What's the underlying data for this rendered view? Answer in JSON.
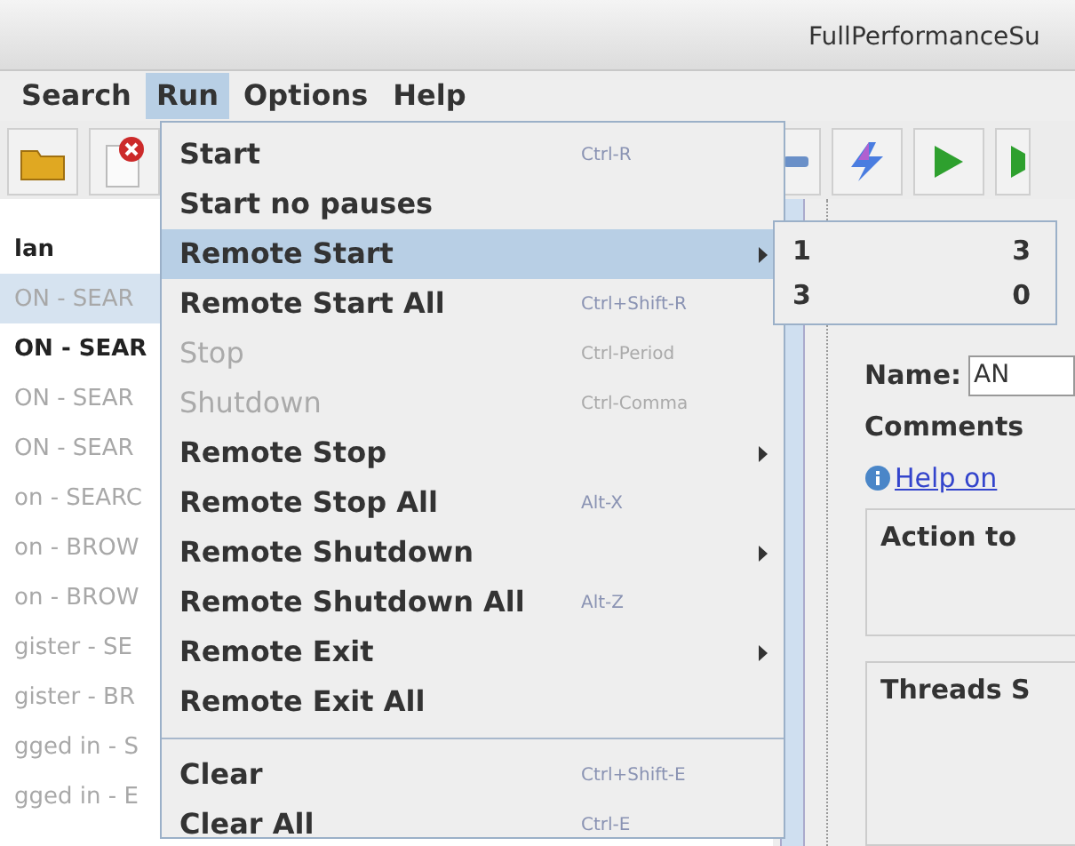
{
  "window": {
    "title": "FullPerformanceSu"
  },
  "menu_bar": [
    {
      "label": "Search",
      "selected": false
    },
    {
      "label": "Run",
      "selected": true
    },
    {
      "label": "Options",
      "selected": false
    },
    {
      "label": "Help",
      "selected": false
    }
  ],
  "tree": [
    {
      "label": "lan",
      "selected": false,
      "disabled": false
    },
    {
      "label": "ON - SEAR",
      "selected": true,
      "disabled": true
    },
    {
      "label": "ON - SEAR",
      "selected": false,
      "disabled": false
    },
    {
      "label": "ON - SEAR",
      "selected": false,
      "disabled": true
    },
    {
      "label": "ON - SEAR",
      "selected": false,
      "disabled": true
    },
    {
      "label": "on - SEARC",
      "selected": false,
      "disabled": true
    },
    {
      "label": "on - BROW",
      "selected": false,
      "disabled": true
    },
    {
      "label": "on - BROW",
      "selected": false,
      "disabled": true
    },
    {
      "label": "gister - SE",
      "selected": false,
      "disabled": true
    },
    {
      "label": "gister - BR",
      "selected": false,
      "disabled": true
    },
    {
      "label": "gged in - S",
      "selected": false,
      "disabled": true
    },
    {
      "label": "gged in - E",
      "selected": false,
      "disabled": true
    }
  ],
  "run_menu": [
    {
      "kind": "item",
      "label": "Start",
      "shortcut": "Ctrl-R",
      "disabled": false,
      "selected": false,
      "submenu": false
    },
    {
      "kind": "item",
      "label": "Start no pauses",
      "disabled": false,
      "selected": false,
      "submenu": false
    },
    {
      "kind": "item",
      "label": "Remote Start",
      "disabled": false,
      "selected": true,
      "submenu": true
    },
    {
      "kind": "item",
      "label": "Remote Start All",
      "shortcut": "Ctrl+Shift-R",
      "disabled": false,
      "selected": false,
      "submenu": false
    },
    {
      "kind": "item",
      "label": "Stop",
      "shortcut": "Ctrl-Period",
      "disabled": true,
      "selected": false,
      "submenu": false
    },
    {
      "kind": "item",
      "label": "Shutdown",
      "shortcut": "Ctrl-Comma",
      "disabled": true,
      "selected": false,
      "submenu": false
    },
    {
      "kind": "item",
      "label": "Remote Stop",
      "disabled": false,
      "selected": false,
      "submenu": true
    },
    {
      "kind": "item",
      "label": "Remote Stop All",
      "shortcut": "Alt-X",
      "disabled": false,
      "selected": false,
      "submenu": false
    },
    {
      "kind": "item",
      "label": "Remote Shutdown",
      "disabled": false,
      "selected": false,
      "submenu": true
    },
    {
      "kind": "item",
      "label": "Remote Shutdown All",
      "shortcut": "Alt-Z",
      "disabled": false,
      "selected": false,
      "submenu": false
    },
    {
      "kind": "item",
      "label": "Remote Exit",
      "disabled": false,
      "selected": false,
      "submenu": true
    },
    {
      "kind": "item",
      "label": "Remote Exit All",
      "disabled": false,
      "selected": false,
      "submenu": false
    },
    {
      "kind": "separator"
    },
    {
      "kind": "item",
      "label": "Clear",
      "shortcut": "Ctrl+Shift-E",
      "disabled": false,
      "selected": false,
      "submenu": false
    },
    {
      "kind": "item",
      "label": "Clear All",
      "shortcut": "Ctrl-E",
      "disabled": false,
      "selected": false,
      "submenu": false
    }
  ],
  "remote_start_submenu": [
    {
      "host": "1",
      "count": "3"
    },
    {
      "host": "3",
      "count": "0"
    }
  ],
  "panel": {
    "name_label": "Name:",
    "name_value": "AN",
    "comments_label": "Comments",
    "help_link": "Help on",
    "action_group": "Action to",
    "threads_group": "Threads S"
  }
}
